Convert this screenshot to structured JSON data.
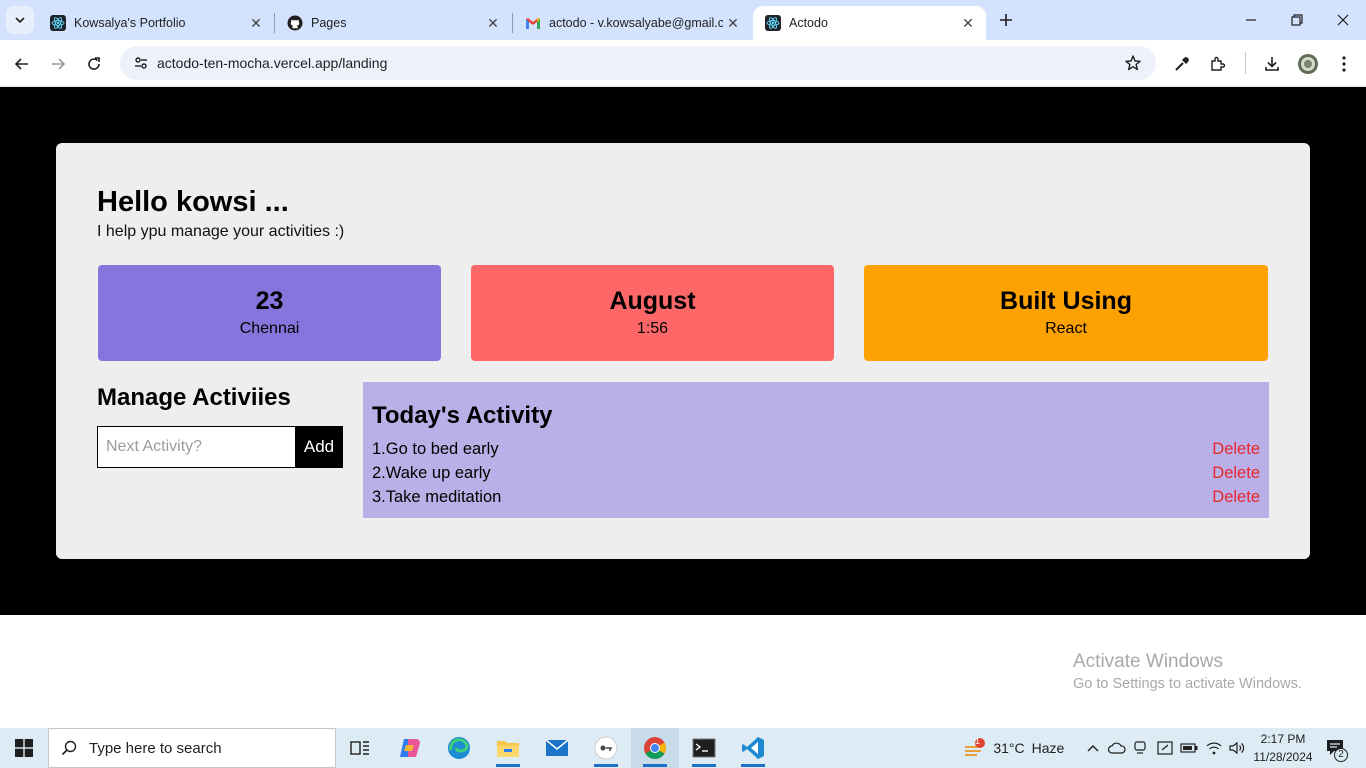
{
  "browser": {
    "tabs": [
      {
        "title": "Kowsalya's Portfolio",
        "icon": "react-icon"
      },
      {
        "title": "Pages",
        "icon": "github-icon"
      },
      {
        "title": "actodo - v.kowsalyabe@gmail.c",
        "icon": "gmail-icon"
      },
      {
        "title": "Actodo",
        "icon": "react-icon",
        "active": true
      }
    ],
    "url": "actodo-ten-mocha.vercel.app/landing"
  },
  "app": {
    "greeting": "Hello kowsi ...",
    "subtitle": "I help ypu manage your activities :)",
    "cards": [
      {
        "big": "23",
        "small": "Chennai",
        "color": "#8675dc"
      },
      {
        "big": "August",
        "small": "1:56",
        "color": "#fd6767"
      },
      {
        "big": "Built Using",
        "small": "React",
        "color": "#fea203"
      }
    ],
    "manage": {
      "title": "Manage Activiies",
      "placeholder": "Next Activity?",
      "add_label": "Add"
    },
    "today": {
      "title": "Today's Activity",
      "delete_label": "Delete",
      "items": [
        "1.Go to bed early",
        "2.Wake up early",
        "3.Take meditation"
      ]
    }
  },
  "watermark": {
    "line1": "Activate Windows",
    "line2": "Go to Settings to activate Windows."
  },
  "taskbar": {
    "search_placeholder": "Type here to search",
    "weather_temp": "31°C",
    "weather_text": "Haze",
    "weather_badge": "1",
    "time": "2:17 PM",
    "date": "11/28/2024",
    "notification_count": "2"
  }
}
